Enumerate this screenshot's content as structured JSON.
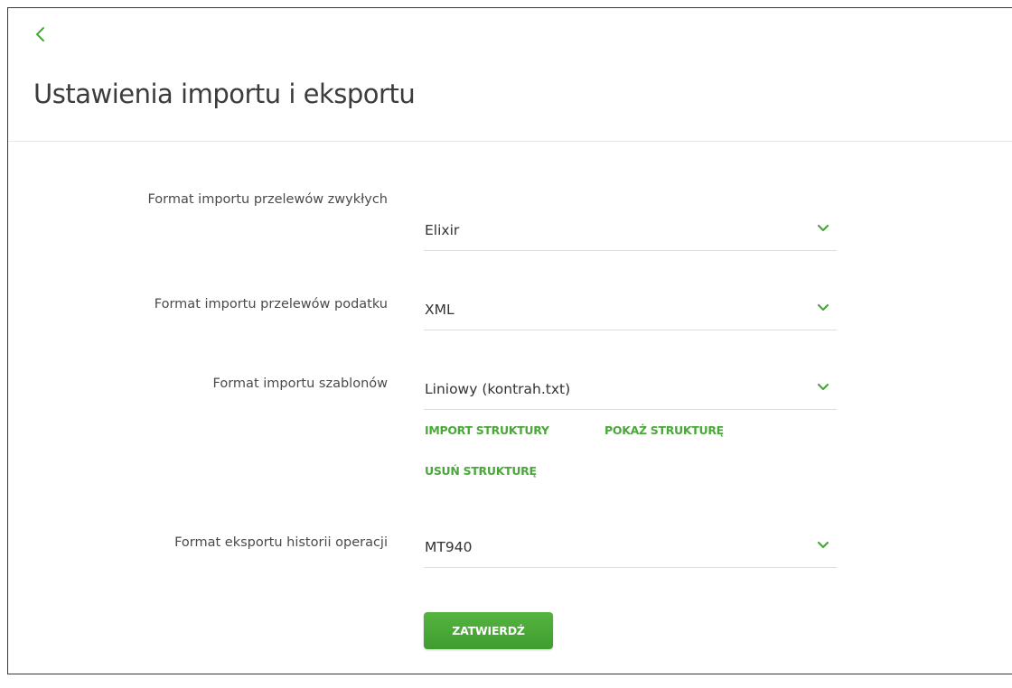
{
  "page": {
    "title": "Ustawienia importu i eksportu",
    "back_icon": "chevron-left-icon"
  },
  "colors": {
    "accent_green": "#4aa83a",
    "button_green": "#4aa83a",
    "text": "#333333",
    "divider": "#e6e6e6"
  },
  "form": {
    "rows": [
      {
        "label": "Format importu przelewów zwykłych",
        "value": "Elixir"
      },
      {
        "label": "Format importu przelewów podatku",
        "value": "XML"
      },
      {
        "label": "Format importu szablonów",
        "value": "Liniowy (kontrah.txt)"
      },
      {
        "label": "Format eksportu historii operacji",
        "value": "MT940"
      }
    ],
    "template_actions": {
      "import": "IMPORT STRUKTURY",
      "show": "POKAŻ STRUKTURĘ",
      "delete": "USUŃ STRUKTURĘ"
    },
    "submit_label": "ZATWIERDŹ"
  }
}
